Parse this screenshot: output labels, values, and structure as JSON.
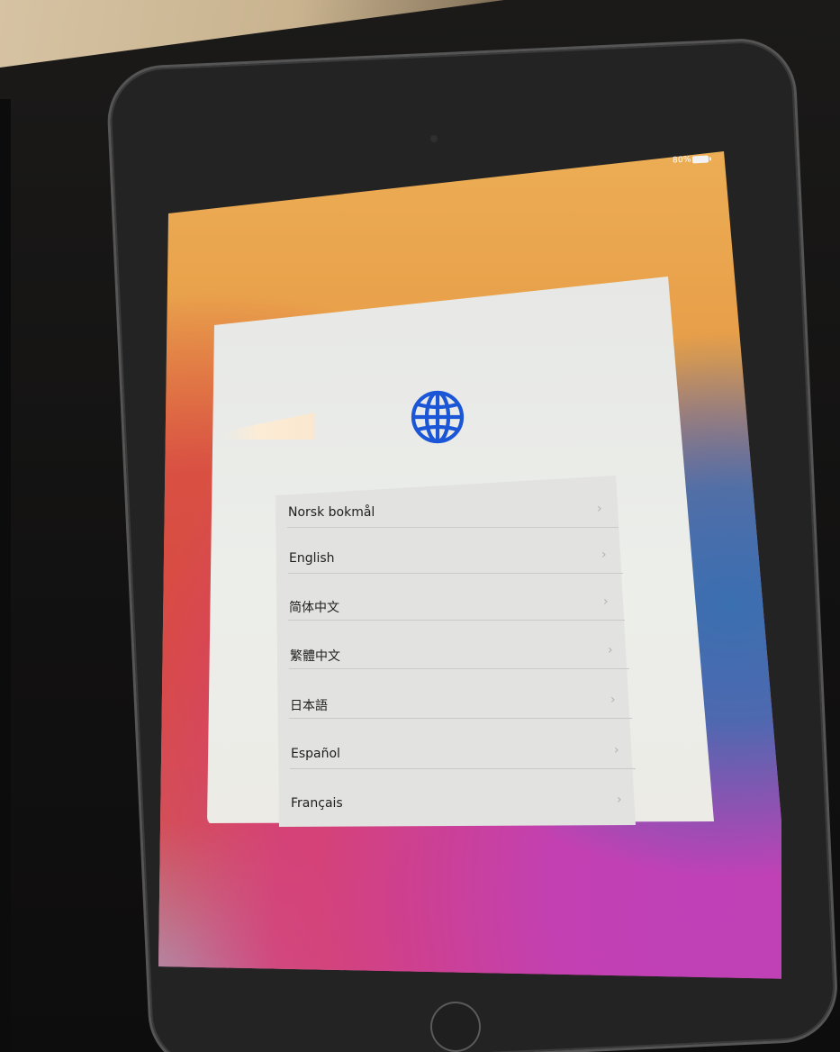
{
  "status_bar": {
    "battery_text": "80%"
  },
  "setup": {
    "icon": "globe-icon",
    "accent_color": "#1a56d6",
    "languages": [
      {
        "label": "Norsk bokmål"
      },
      {
        "label": "English"
      },
      {
        "label": "简体中文"
      },
      {
        "label": "繁體中文"
      },
      {
        "label": "日本語"
      },
      {
        "label": "Español"
      },
      {
        "label": "Français"
      }
    ]
  }
}
